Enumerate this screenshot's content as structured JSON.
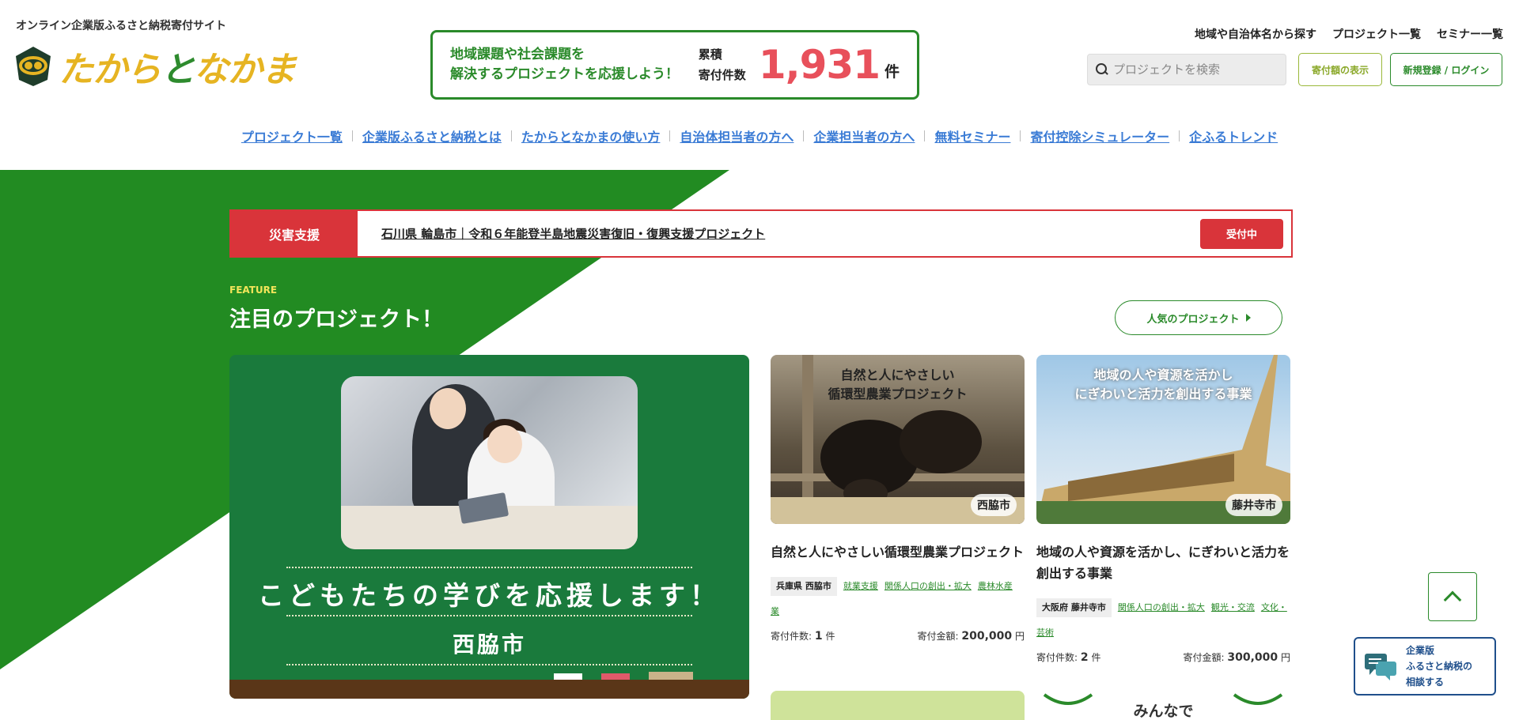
{
  "header": {
    "tagline": "オンライン企業版ふるさと納税寄付サイト",
    "logo_text_a": "たから",
    "logo_text_b": "と",
    "logo_text_c": "なかま",
    "counter": {
      "message_line1": "地域課題や社会課題を",
      "message_line2": "解決するプロジェクトを応援しよう！",
      "label_line1": "累積",
      "label_line2": "寄付件数",
      "value": "1,931",
      "unit": "件"
    },
    "top_links": [
      "地域や自治体名から探す",
      "プロジェクト一覧",
      "セミナー一覧"
    ],
    "search_placeholder": "プロジェクトを検索",
    "amount_button": "寄付額の表示",
    "login_button": "新規登録 / ログイン"
  },
  "nav": [
    "プロジェクト一覧",
    "企業版ふるさと納税とは",
    "たからとなかまの使い方",
    "自治体担当者の方へ",
    "企業担当者の方へ",
    "無料セミナー",
    "寄付控除シミュレーター",
    "企ふるトレンド"
  ],
  "disaster": {
    "tag": "災害支援",
    "link": "石川県 輪島市｜令和６年能登半島地震災害復旧・復興支援プロジェクト",
    "status": "受付中"
  },
  "feature": {
    "eyebrow": "FEATURE",
    "title": "注目のプロジェクト！",
    "popular_button": "人気のプロジェクト",
    "big_card": {
      "line1": "こどもたちの学びを応援します！",
      "line2": "西脇市"
    },
    "cards": [
      {
        "image_text_line1": "自然と人にやさしい",
        "image_text_line2": "循環型農業プロジェクト",
        "city_badge": "西脇市",
        "title": "自然と人にやさしい循環型農業プロジェクト",
        "pref": "兵庫県 西脇市",
        "categories": [
          "就業支援",
          "関係人口の創出・拡大",
          "農林水産業"
        ],
        "count_label": "寄付件数:",
        "count_value": "1",
        "count_unit": "件",
        "amount_label": "寄付金額:",
        "amount_value": "200,000",
        "amount_unit": "円"
      },
      {
        "image_text_line1": "地域の人や資源を活かし",
        "image_text_line2": "にぎわいと活力を創出する事業",
        "city_badge": "藤井寺市",
        "title": "地域の人や資源を活かし、にぎわいと活力を創出する事業",
        "pref": "大阪府 藤井寺市",
        "categories": [
          "関係人口の創出・拡大",
          "観光・交流",
          "文化・芸術"
        ],
        "count_label": "寄付件数:",
        "count_value": "2",
        "count_unit": "件",
        "amount_label": "寄付金額:",
        "amount_value": "300,000",
        "amount_unit": "円"
      }
    ],
    "next_card_text": "みんなで"
  },
  "floating": {
    "consult_line1": "企業版",
    "consult_line2": "ふるさと納税の",
    "consult_line3": "相談する"
  },
  "colors": {
    "brand_green": "#2a8a2a",
    "hero_green": "#228b22",
    "counter_red": "#e8505b",
    "disaster_red": "#d9343a",
    "nav_blue": "#3a7bd5",
    "logo_gold": "#e6b422"
  }
}
